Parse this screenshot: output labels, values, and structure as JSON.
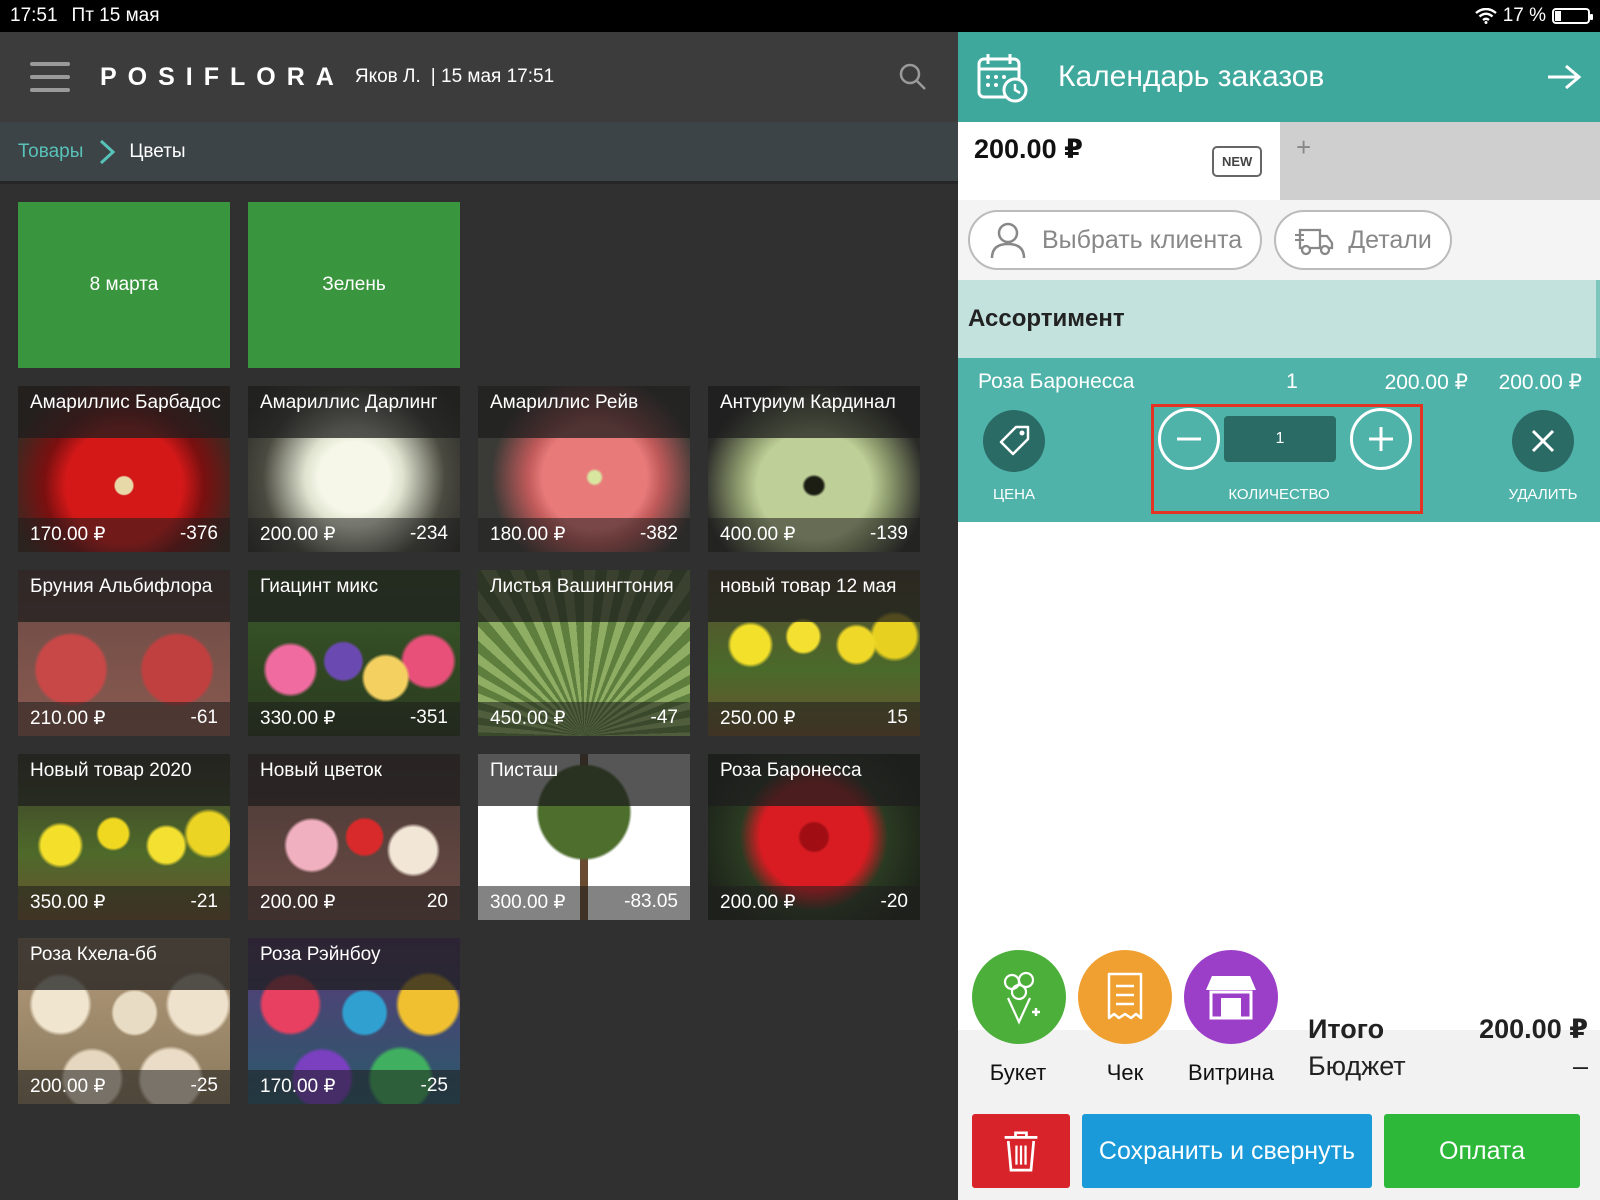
{
  "status": {
    "time": "17:51",
    "date": "Пт 15 мая",
    "battery": "17 %"
  },
  "header": {
    "logo": "POSIFLORA",
    "user": "Яков Л.",
    "session": "| 15 мая 17:51"
  },
  "breadcrumb": {
    "parent": "Товары",
    "current": "Цветы"
  },
  "categories": [
    {
      "label": "8 марта"
    },
    {
      "label": "Зелень"
    }
  ],
  "products": [
    {
      "name": "Амариллис Барбадос",
      "price": "170.00 ₽",
      "stock": "-376"
    },
    {
      "name": "Амариллис Дарлинг",
      "price": "200.00 ₽",
      "stock": "-234"
    },
    {
      "name": "Амариллис Рейв",
      "price": "180.00 ₽",
      "stock": "-382"
    },
    {
      "name": "Антуриум Кардинал",
      "price": "400.00 ₽",
      "stock": "-139"
    },
    {
      "name": "Бруния Альбифлора",
      "price": "210.00 ₽",
      "stock": "-61"
    },
    {
      "name": "Гиацинт микс",
      "price": "330.00 ₽",
      "stock": "-351"
    },
    {
      "name": "Листья Вашингтония",
      "price": "450.00 ₽",
      "stock": "-47"
    },
    {
      "name": "новый товар 12 мая",
      "price": "250.00 ₽",
      "stock": "15"
    },
    {
      "name": "Новый товар 2020",
      "price": "350.00 ₽",
      "stock": "-21"
    },
    {
      "name": "Новый цветок",
      "price": "200.00 ₽",
      "stock": "20"
    },
    {
      "name": "Писташ",
      "price": "300.00 ₽",
      "stock": "-83.05"
    },
    {
      "name": "Роза Баронесса",
      "price": "200.00 ₽",
      "stock": "-20"
    },
    {
      "name": "Роза Кхела-бб",
      "price": "200.00 ₽",
      "stock": "-25"
    },
    {
      "name": "Роза Рэйнбоу",
      "price": "170.00 ₽",
      "stock": "-25"
    }
  ],
  "order": {
    "title": "Календарь заказов",
    "amount": "200.00 ₽",
    "badge": "NEW",
    "add_tab": "+",
    "client_button": "Выбрать клиента",
    "details_button": "Детали",
    "section": "Ассортимент",
    "item": {
      "name": "Роза Баронесса",
      "qty": "1",
      "price": "200.00 ₽",
      "total": "200.00 ₽",
      "qty_value": "1",
      "price_label": "ЦЕНА",
      "qty_label": "КОЛИЧЕСТВО",
      "delete_label": "УДАЛИТЬ"
    },
    "actions": {
      "bouquet": "Букет",
      "receipt": "Чек",
      "showcase": "Витрина"
    },
    "summary": {
      "total_label": "Итого",
      "total_value": "200.00 ₽",
      "budget_label": "Бюджет",
      "budget_value": "–"
    },
    "buttons": {
      "save": "Сохранить и свернуть",
      "pay": "Оплата"
    },
    "colors": {
      "accent": "#3fa89d",
      "bouquet": "#4caf3a",
      "receipt": "#f0a030",
      "showcase": "#9c3fc8",
      "delete": "#d9232a",
      "save": "#1a9ad8",
      "pay": "#2db83a"
    }
  }
}
